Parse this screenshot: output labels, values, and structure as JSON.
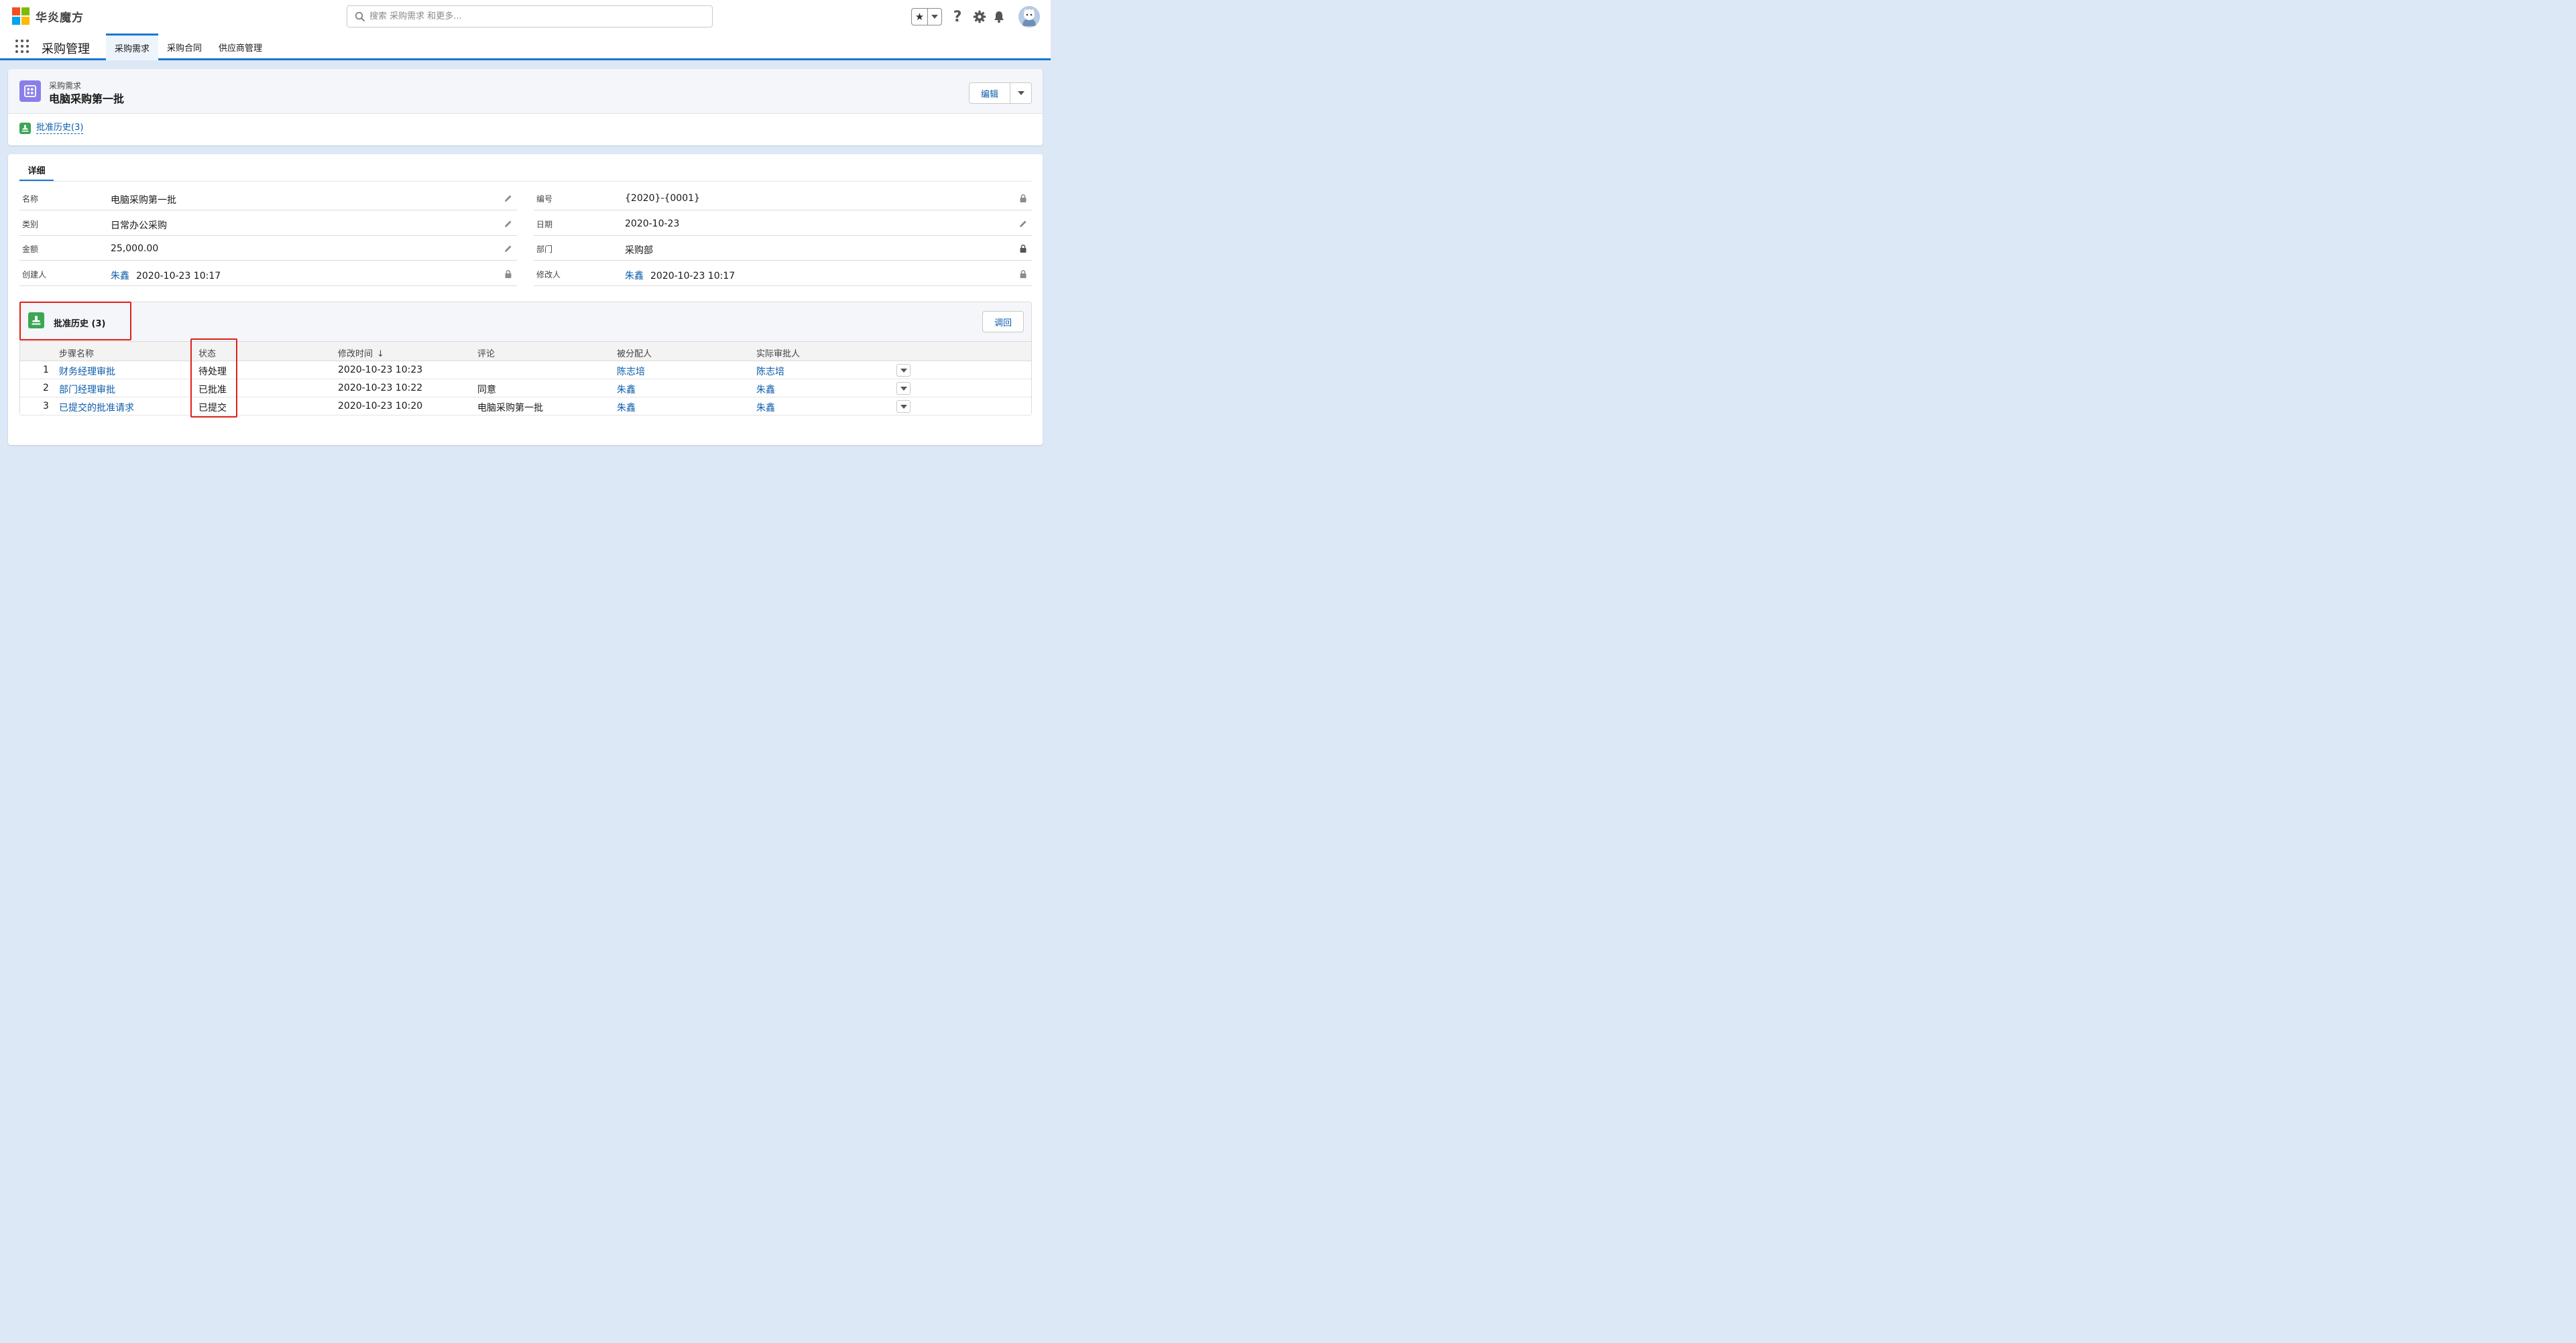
{
  "brand": {
    "name": "华炎魔方"
  },
  "search": {
    "placeholder": "搜索 采购需求 和更多..."
  },
  "header": {
    "help_glyph": "?"
  },
  "nav": {
    "app_name": "采购管理",
    "tabs": [
      {
        "label": "采购需求",
        "active": true
      },
      {
        "label": "采购合同",
        "active": false
      },
      {
        "label": "供应商管理",
        "active": false
      }
    ]
  },
  "record": {
    "type_label": "采购需求",
    "title": "电脑采购第一批",
    "edit_label": "编辑",
    "related_link": "批准历史(3)"
  },
  "detail": {
    "tab_label": "详细",
    "left_fields": [
      {
        "label": "名称",
        "value": "电脑采购第一批",
        "icon": "pencil-icon"
      },
      {
        "label": "类别",
        "value": "日常办公采购",
        "icon": "pencil-icon"
      },
      {
        "label": "金额",
        "value": "25,000.00",
        "icon": "pencil-icon"
      },
      {
        "label": "创建人",
        "user": "朱鑫",
        "value": "2020-10-23 10:17",
        "icon": "lock-icon"
      }
    ],
    "right_fields": [
      {
        "label": "编号",
        "value": "{2020}-{0001}",
        "icon": "lock-icon"
      },
      {
        "label": "日期",
        "value": "2020-10-23",
        "icon": "pencil-icon"
      },
      {
        "label": "部门",
        "value": "采购部",
        "icon": "lock-icon"
      },
      {
        "label": "修改人",
        "user": "朱鑫",
        "value": "2020-10-23 10:17",
        "icon": "lock-icon"
      }
    ]
  },
  "approval": {
    "title": "批准历史 (3)",
    "recall_label": "调回",
    "columns": [
      "步骤名称",
      "状态",
      "修改时间",
      "评论",
      "被分配人",
      "实际审批人"
    ],
    "sort_glyph": "↓",
    "rows": [
      {
        "index": "1",
        "step": "财务经理审批",
        "status": "待处理",
        "time": "2020-10-23 10:23",
        "comment": "",
        "assignee": "陈志培",
        "approver": "陈志培"
      },
      {
        "index": "2",
        "step": "部门经理审批",
        "status": "已批准",
        "time": "2020-10-23 10:22",
        "comment": "同意",
        "assignee": "朱鑫",
        "approver": "朱鑫"
      },
      {
        "index": "3",
        "step": "已提交的批准请求",
        "status": "已提交",
        "time": "2020-10-23 10:20",
        "comment": "电脑采购第一批",
        "assignee": "朱鑫",
        "approver": "朱鑫"
      }
    ]
  },
  "colors": {
    "accent": "#1b76d3",
    "link": "#0b5cab",
    "record_icon": "#8a7fe8",
    "approval_icon": "#3ba755",
    "highlight": "#e0201a",
    "background": "#dde8f6"
  }
}
